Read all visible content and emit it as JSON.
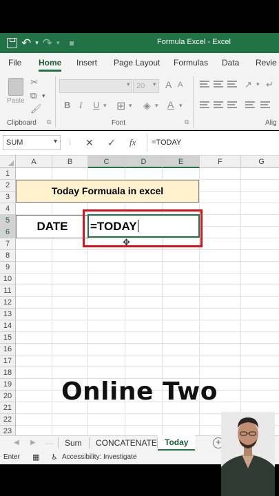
{
  "window": {
    "title": "Formula Excel  -  Excel",
    "quick_access": {
      "save_icon": "save-icon",
      "undo_icon": "↶",
      "redo_icon": "↷",
      "customize_icon": "≡"
    }
  },
  "ribbon_tabs": [
    {
      "label": "File"
    },
    {
      "label": "Home"
    },
    {
      "label": "Insert"
    },
    {
      "label": "Page Layout"
    },
    {
      "label": "Formulas"
    },
    {
      "label": "Data"
    },
    {
      "label": "Revie"
    }
  ],
  "ribbon": {
    "clipboard": {
      "paste_label": "Paste",
      "group_label": "Clipboard"
    },
    "font": {
      "size_value": "20",
      "bold": "B",
      "italic": "I",
      "underline": "U",
      "grow": "A",
      "shrink": "A",
      "group_label": "Font"
    },
    "alignment": {
      "group_label": "Alig"
    }
  },
  "formula_bar": {
    "name_box": "SUM",
    "cancel": "✕",
    "enter": "✓",
    "fx": "fx",
    "content": "=TODAY"
  },
  "grid": {
    "columns": [
      "A",
      "B",
      "C",
      "D",
      "E",
      "F",
      "G"
    ],
    "rows": [
      "1",
      "2",
      "3",
      "4",
      "5",
      "6",
      "7",
      "8",
      "9",
      "10",
      "11",
      "12",
      "13",
      "14",
      "15",
      "16",
      "17",
      "18",
      "19",
      "20",
      "21",
      "22",
      "23"
    ],
    "title_cell": "Today Formuala in excel",
    "date_label": "DATE",
    "editing_text": "=TODAY"
  },
  "sheets": {
    "tabs": [
      "Sum",
      "CONCATENATE",
      "Today"
    ],
    "active": "Today",
    "add_label": "+"
  },
  "status": {
    "mode": "Enter",
    "accessibility": "Accessibility: Investigate"
  },
  "overlay": {
    "caption": "Online Two"
  }
}
